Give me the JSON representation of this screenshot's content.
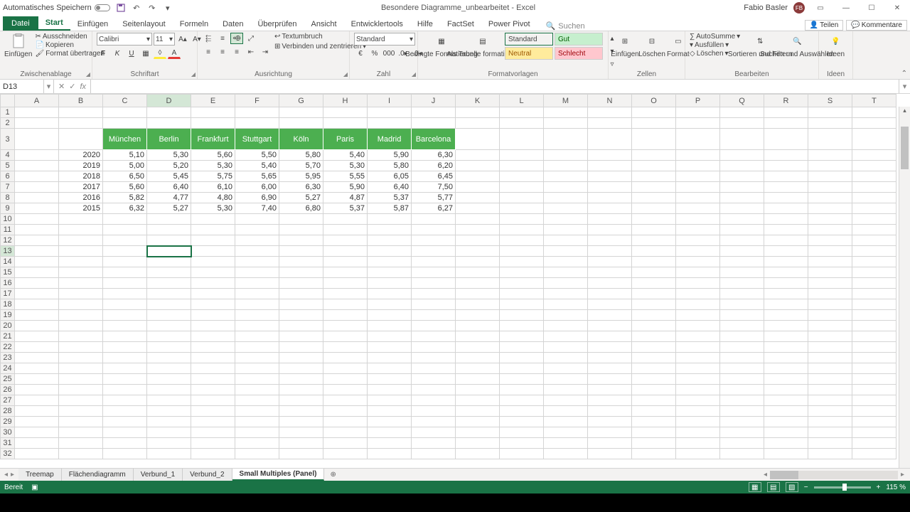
{
  "title": {
    "autosave": "Automatisches Speichern",
    "doc": "Besondere Diagramme_unbearbeitet",
    "app": "Excel",
    "user": "Fabio Basler"
  },
  "tabs": {
    "file": "Datei",
    "home": "Start",
    "insert": "Einfügen",
    "layout": "Seitenlayout",
    "formulas": "Formeln",
    "data": "Daten",
    "review": "Überprüfen",
    "view": "Ansicht",
    "dev": "Entwicklertools",
    "help": "Hilfe",
    "factset": "FactSet",
    "pivot": "Power Pivot",
    "search": "Suchen",
    "share": "Teilen",
    "comments": "Kommentare"
  },
  "ribbon": {
    "clipboard": {
      "paste": "Einfügen",
      "cut": "Ausschneiden",
      "copy": "Kopieren",
      "format_painter": "Format übertragen",
      "label": "Zwischenablage"
    },
    "font": {
      "name": "Calibri",
      "size": "11",
      "label": "Schriftart"
    },
    "align": {
      "wrap": "Textumbruch",
      "merge": "Verbinden und zentrieren",
      "label": "Ausrichtung"
    },
    "number": {
      "format": "Standard",
      "label": "Zahl"
    },
    "styles": {
      "cond": "Bedingte Formatierung",
      "table": "Als Tabelle formatieren",
      "standard": "Standard",
      "gut": "Gut",
      "neutral": "Neutral",
      "schlecht": "Schlecht",
      "label": "Formatvorlagen"
    },
    "cells": {
      "insert": "Einfügen",
      "delete": "Löschen",
      "format": "Format",
      "label": "Zellen"
    },
    "editing": {
      "sum": "AutoSumme",
      "fill": "Ausfüllen",
      "clear": "Löschen",
      "sort": "Sortieren und Filtern",
      "find": "Suchen und Auswählen",
      "label": "Bearbeiten"
    },
    "ideas": {
      "btn": "Ideen",
      "label": "Ideen"
    }
  },
  "namebox": "D13",
  "columns": [
    "A",
    "B",
    "C",
    "D",
    "E",
    "F",
    "G",
    "H",
    "I",
    "J",
    "K",
    "L",
    "M",
    "N",
    "O",
    "P",
    "Q",
    "R",
    "S",
    "T"
  ],
  "headers": [
    "München",
    "Berlin",
    "Frankfurt",
    "Stuttgart",
    "Köln",
    "Paris",
    "Madrid",
    "Barcelona"
  ],
  "years": [
    "2020",
    "2019",
    "2018",
    "2017",
    "2016",
    "2015"
  ],
  "values": [
    [
      "5,10",
      "5,30",
      "5,60",
      "5,50",
      "5,80",
      "5,40",
      "5,90",
      "6,30"
    ],
    [
      "5,00",
      "5,20",
      "5,30",
      "5,40",
      "5,70",
      "5,30",
      "5,80",
      "6,20"
    ],
    [
      "6,50",
      "5,45",
      "5,75",
      "5,65",
      "5,95",
      "5,55",
      "6,05",
      "6,45"
    ],
    [
      "5,60",
      "6,40",
      "6,10",
      "6,00",
      "6,30",
      "5,90",
      "6,40",
      "7,50"
    ],
    [
      "5,82",
      "4,77",
      "4,80",
      "6,90",
      "5,27",
      "4,87",
      "5,37",
      "5,77"
    ],
    [
      "6,32",
      "5,27",
      "5,30",
      "7,40",
      "6,80",
      "5,37",
      "5,87",
      "6,27"
    ]
  ],
  "sheets": {
    "treemap": "Treemap",
    "area": "Flächendiagramm",
    "combo1": "Verbund_1",
    "combo2": "Verbund_2",
    "panel": "Small Multiples (Panel)"
  },
  "status": {
    "ready": "Bereit",
    "zoom": "115 %"
  }
}
